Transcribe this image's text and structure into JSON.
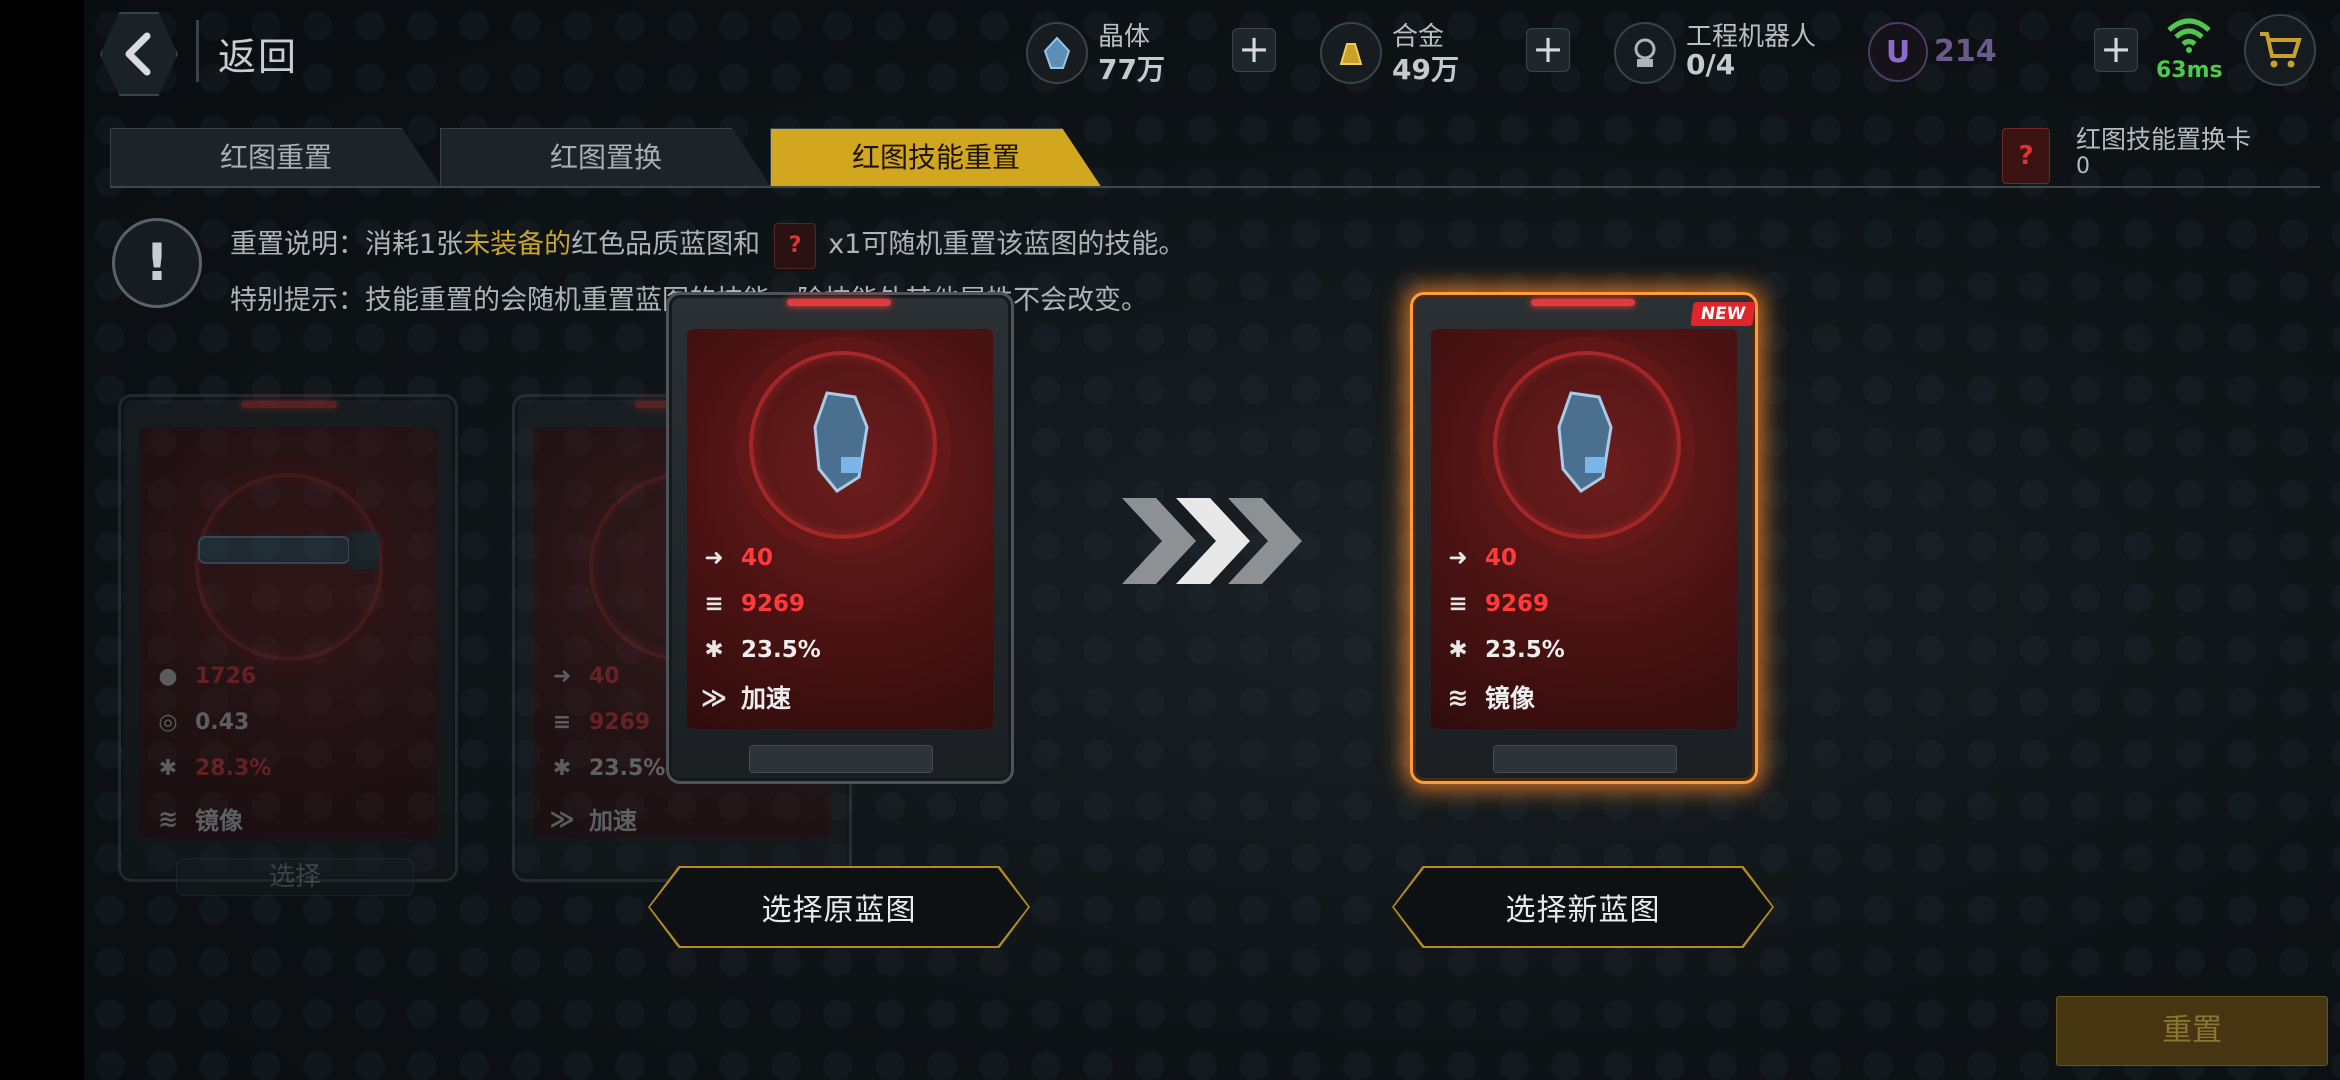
{
  "topbar": {
    "back_label": "返回",
    "crystal_label": "晶体",
    "crystal_value": "77万",
    "alloy_label": "合金",
    "alloy_value": "49万",
    "robot_label": "工程机器人",
    "robot_value": "0/4",
    "u_icon": "U",
    "u_value": "214",
    "ping": "63ms"
  },
  "tabs": [
    {
      "label": "红图重置"
    },
    {
      "label": "红图置换"
    },
    {
      "label": "红图技能重置"
    }
  ],
  "reset_card": {
    "label": "红图技能置换卡",
    "value": "0",
    "icon_glyph": "?"
  },
  "info": {
    "line1_prefix": "重置说明：消耗1张",
    "line1_highlight": "未装备的",
    "line1_mid": "红色品质蓝图和",
    "line1_suffix": "x1可随机重置该蓝图的技能。",
    "line2": "特别提示：技能重置的会随机重置蓝图的技能，除技能外其他属性不会改变。"
  },
  "bg_cards": [
    {
      "stats": [
        "1726",
        "0.43",
        "28.3%"
      ],
      "skill": "镜像",
      "select_label": "选择"
    },
    {
      "stats": [
        "40",
        "9269",
        "23.5%"
      ],
      "skill": "加速"
    }
  ],
  "original": {
    "speed": "40",
    "power": "9269",
    "crit": "23.5%",
    "skill": "加速",
    "button": "选择原蓝图"
  },
  "new": {
    "badge": "NEW",
    "speed": "40",
    "power": "9269",
    "crit": "23.5%",
    "skill": "镜像",
    "button": "选择新蓝图"
  },
  "reset_button": "重置",
  "colors": {
    "accent_gold": "#d2a61e",
    "stat_red": "#ff3b3b",
    "glow_orange": "#ff8a2a",
    "ping_green": "#4ec94a"
  }
}
